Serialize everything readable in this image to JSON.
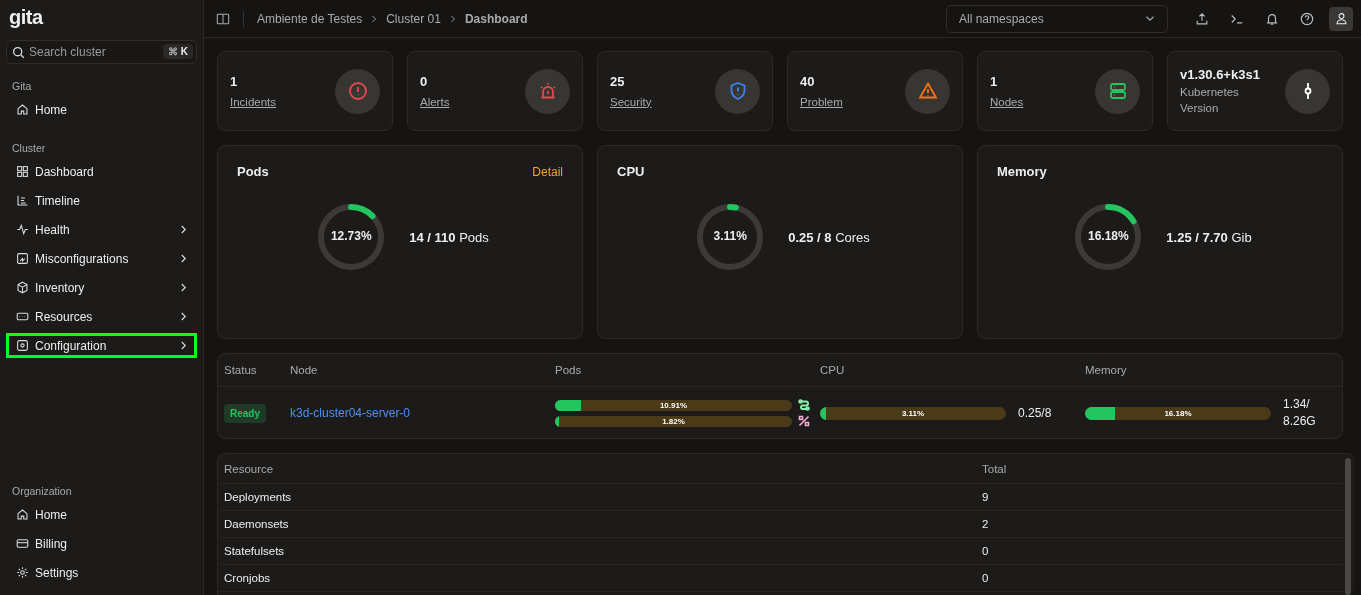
{
  "sidebar": {
    "logo": "gita",
    "search": {
      "placeholder": "Search cluster",
      "shortcut_symbol": "⌘",
      "shortcut_key": "K"
    },
    "sections": [
      {
        "title": "Gita",
        "items": [
          {
            "label": "Home",
            "expandable": false,
            "selected": false
          }
        ]
      },
      {
        "title": "Cluster",
        "items": [
          {
            "label": "Dashboard",
            "expandable": false,
            "selected": false
          },
          {
            "label": "Timeline",
            "expandable": false,
            "selected": false
          },
          {
            "label": "Health",
            "expandable": true,
            "selected": false
          },
          {
            "label": "Misconfigurations",
            "expandable": true,
            "selected": false
          },
          {
            "label": "Inventory",
            "expandable": true,
            "selected": false
          },
          {
            "label": "Resources",
            "expandable": true,
            "selected": false
          },
          {
            "label": "Configuration",
            "expandable": true,
            "selected": true
          }
        ]
      }
    ],
    "bottom_section": {
      "title": "Organization",
      "items": [
        {
          "label": "Home",
          "expandable": false,
          "selected": false
        },
        {
          "label": "Billing",
          "expandable": false,
          "selected": false
        },
        {
          "label": "Settings",
          "expandable": false,
          "selected": false
        }
      ]
    }
  },
  "breadcrumb": [
    "Ambiente de Testes",
    "Cluster 01",
    "Dashboard"
  ],
  "namespace_select": "All namespaces",
  "stats": [
    {
      "value": "1",
      "label": "Incidents",
      "link": true,
      "color": "#e5484d"
    },
    {
      "value": "0",
      "label": "Alerts",
      "link": true,
      "color": "#e5484d"
    },
    {
      "value": "25",
      "label": "Security",
      "link": true,
      "color": "#3b82f6"
    },
    {
      "value": "40",
      "label": "Problem",
      "link": true,
      "color": "#f97316"
    },
    {
      "value": "1",
      "label": "Nodes",
      "link": true,
      "color": "#22c55e"
    },
    {
      "value": "v1.30.6+k3s1",
      "label": "Kubernetes Version",
      "link": false,
      "color": "#ffffff"
    }
  ],
  "gauges": [
    {
      "title": "Pods",
      "detail": "Detail",
      "percent": "12.73%",
      "level": 0.1273,
      "used": "14 / 110",
      "unit": "Pods"
    },
    {
      "title": "CPU",
      "percent": "3.11%",
      "level": 0.0311,
      "used": "0.25 / 8",
      "unit": "Cores"
    },
    {
      "title": "Memory",
      "percent": "16.18%",
      "level": 0.1618,
      "used": "1.25 / 7.70",
      "unit": "Gib"
    }
  ],
  "nodes_table": {
    "columns": [
      "Status",
      "Node",
      "Pods",
      "CPU",
      "Memory"
    ],
    "rows": [
      {
        "status": "Ready",
        "node": "k3d-cluster04-server-0",
        "pods": [
          {
            "label": "10.91%",
            "level": 0.1091,
            "color": "#86efac"
          },
          {
            "label": "1.82%",
            "level": 0.0182,
            "color": "#f9a8d4"
          }
        ],
        "cpu": {
          "label": "3.11%",
          "level": 0.0311,
          "reading": "0.25/8"
        },
        "memory": {
          "label": "16.18%",
          "level": 0.1618,
          "reading": "1.34/ 8.26G"
        }
      }
    ]
  },
  "resources_table": {
    "columns": [
      "Resource",
      "Total"
    ],
    "rows": [
      [
        "Deployments",
        "9"
      ],
      [
        "Daemonsets",
        "2"
      ],
      [
        "Statefulsets",
        "0"
      ],
      [
        "Cronjobs",
        "0"
      ]
    ]
  }
}
